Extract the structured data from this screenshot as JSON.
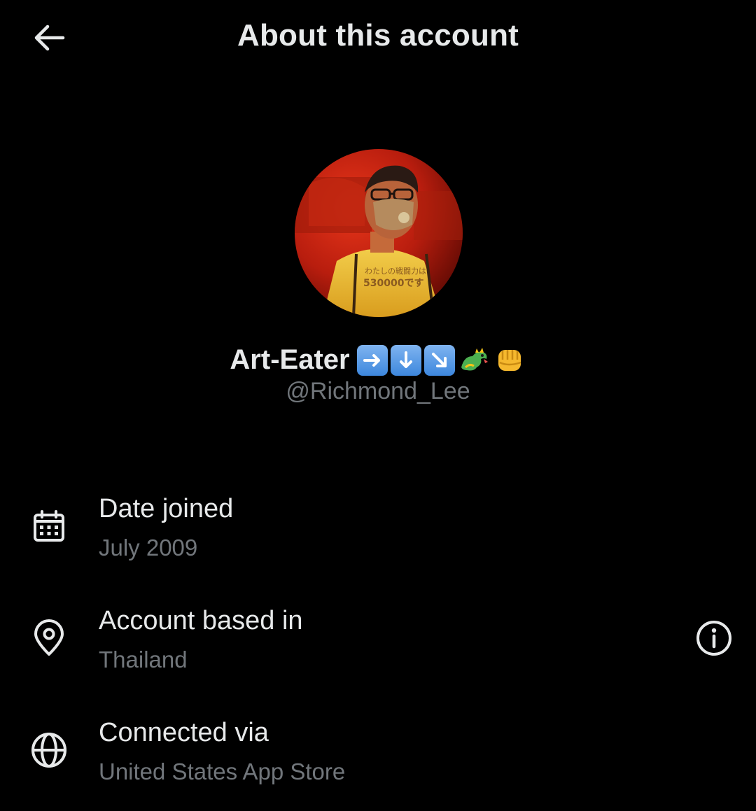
{
  "header": {
    "title": "About this account",
    "back_icon": "arrow-left-icon"
  },
  "profile": {
    "display_name": "Art-Eater",
    "name_emojis": [
      "right-arrow-emoji",
      "down-arrow-emoji",
      "down-right-arrow-emoji",
      "dragon-emoji",
      "fist-emoji"
    ],
    "handle": "@Richmond_Lee",
    "avatar_text_lines": [
      "わたしの戦闘力は",
      "530000です"
    ]
  },
  "details": [
    {
      "icon": "calendar-icon",
      "label": "Date joined",
      "value": "July 2009"
    },
    {
      "icon": "location-pin-icon",
      "label": "Account based in",
      "value": "Thailand",
      "info_icon": "info-icon"
    },
    {
      "icon": "globe-icon",
      "label": "Connected via",
      "value": "United States App Store"
    }
  ],
  "colors": {
    "background": "#000000",
    "primary_text": "#e7e9ea",
    "secondary_text": "#71767b"
  }
}
